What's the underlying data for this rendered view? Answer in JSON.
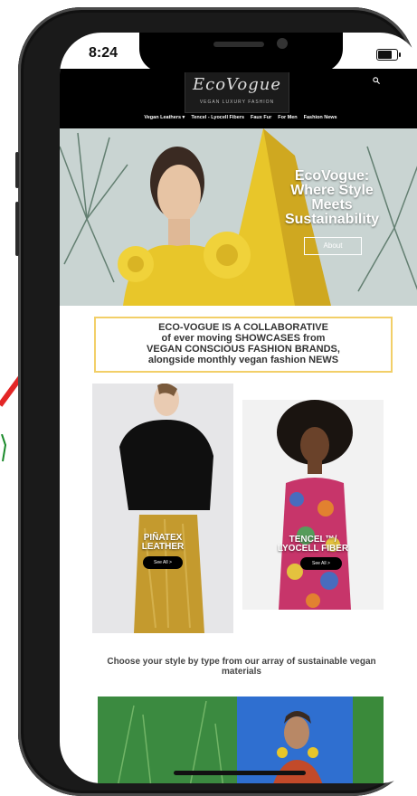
{
  "status": {
    "time": "8:24"
  },
  "header": {
    "logo_text": "EcoVogue",
    "logo_subtitle": "VEGAN LUXURY FASHION",
    "nav": [
      "Vegan Leathers ▾",
      "Tencel - Lyocell Fibers",
      "Faux Fur",
      "For Men",
      "Fashion News"
    ]
  },
  "hero": {
    "title_lines": [
      "EcoVogue:",
      "Where Style",
      "Meets",
      "Sustainability"
    ],
    "button_label": "About"
  },
  "callout": {
    "lines": [
      "ECO-VOGUE IS A COLLABORATIVE",
      "of ever moving SHOWCASES from",
      "VEGAN CONSCIOUS FASHION BRANDS,",
      "alongside monthly vegan fashion NEWS"
    ]
  },
  "cards": [
    {
      "title_lines": [
        "PIÑATEX",
        "LEATHER"
      ],
      "button_label": "See All >"
    },
    {
      "title_lines": [
        "TENCEL™/",
        "LYOCELL FIBER"
      ],
      "button_label": "See All >"
    }
  ],
  "choose_text": "Choose your style by type from  our array of sustainable vegan materials",
  "colors": {
    "accent_border": "#f2cf68",
    "header_bg": "#000000",
    "hero_yellow": "#e8c62a",
    "arrow_red": "#e32626"
  }
}
